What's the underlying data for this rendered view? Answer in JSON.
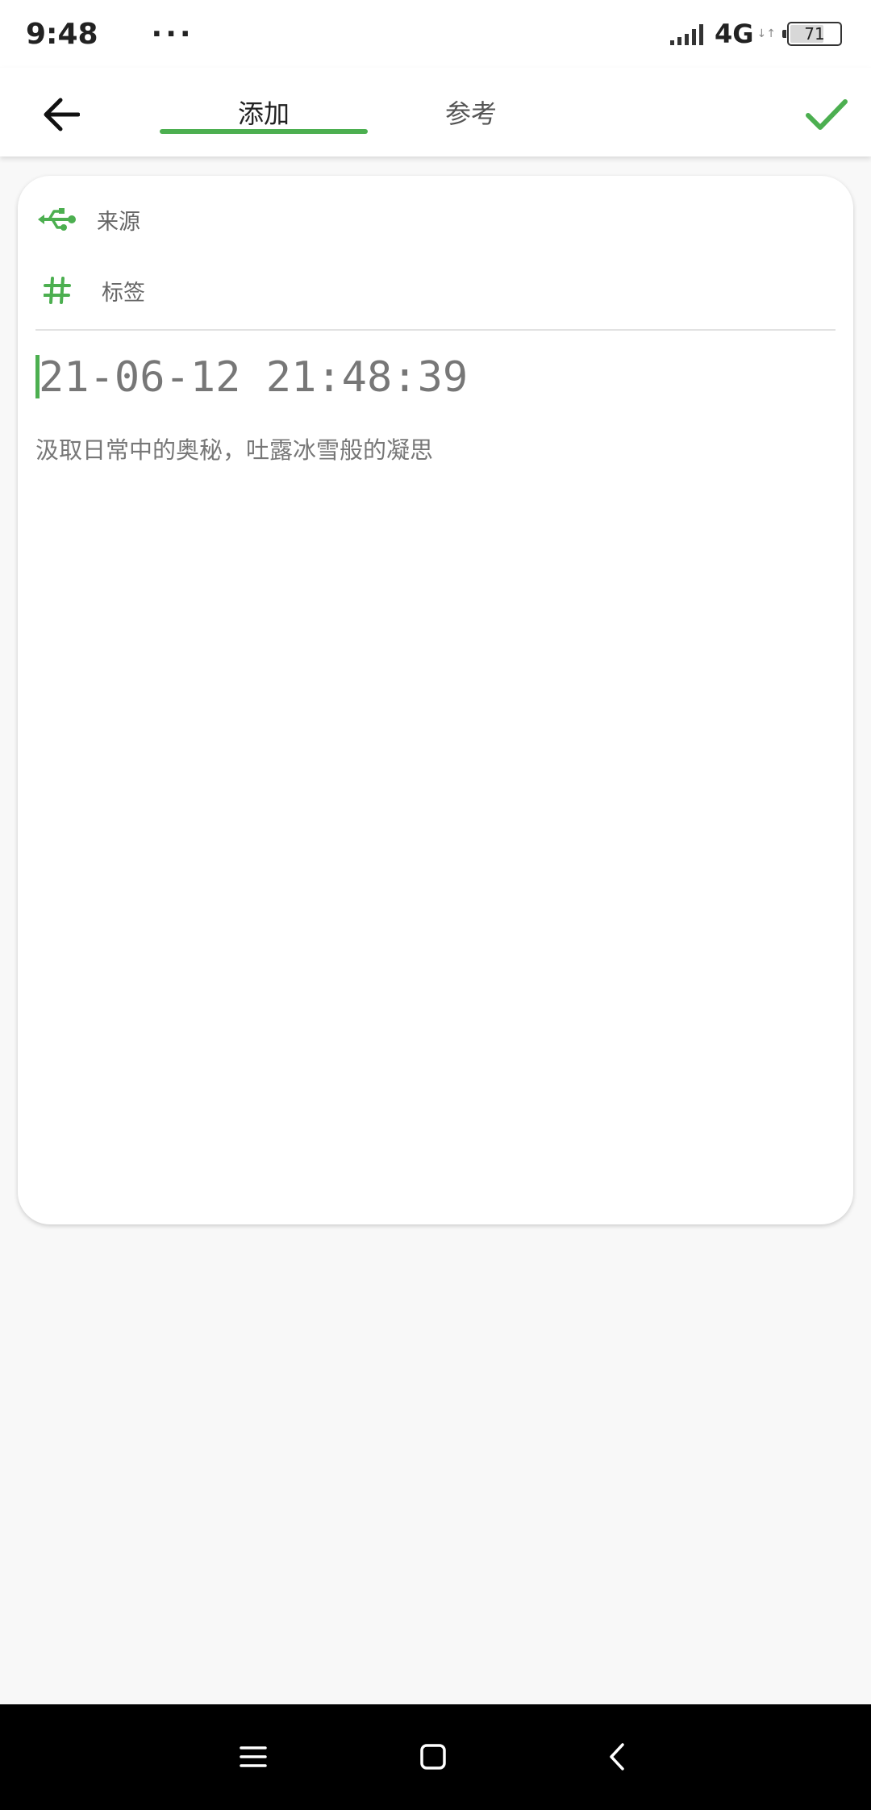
{
  "status_bar": {
    "time": "9:48",
    "overflow_dots": "···",
    "network_type": "4G",
    "network_activity": "↓↑",
    "battery_level": "71",
    "battery_fraction": 0.71
  },
  "app_bar": {
    "tabs": [
      {
        "label": "添加",
        "selected": true
      },
      {
        "label": "参考",
        "selected": false
      }
    ],
    "back_icon": "arrow-left-icon",
    "confirm_icon": "check-icon",
    "accent_color": "#4caf50"
  },
  "editor": {
    "source_label": "来源",
    "source_icon": "usb-icon",
    "tag_label": "标签",
    "tag_icon": "hashtag-icon",
    "title_value": "21-06-12 21:48:39",
    "body_placeholder": "汲取日常中的奥秘，吐露冰雪般的凝思"
  },
  "nav_bar": {
    "menu_icon": "menu-icon",
    "home_icon": "home-square-icon",
    "back_icon": "chevron-left-icon"
  }
}
